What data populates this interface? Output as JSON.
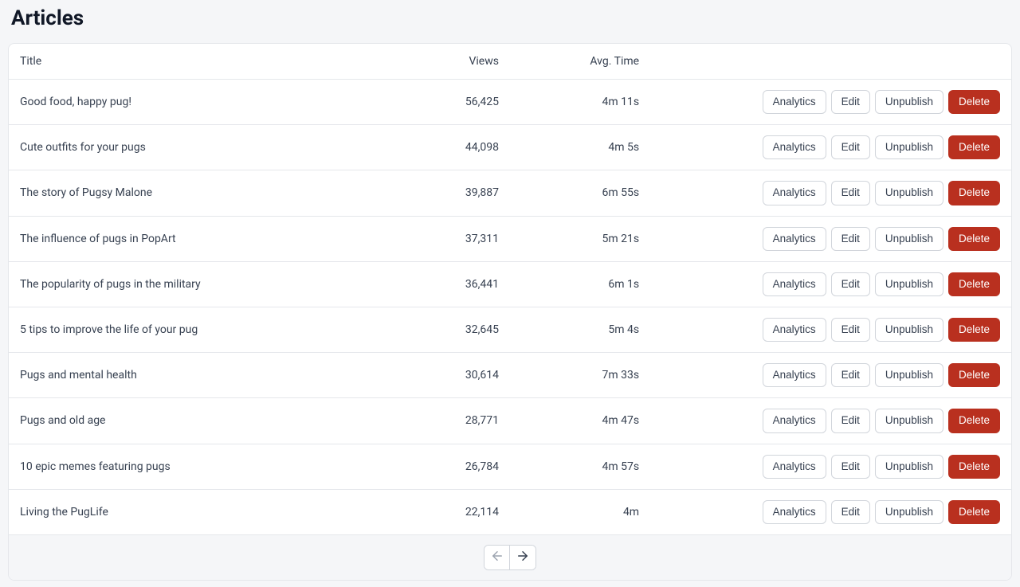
{
  "page": {
    "title": "Articles"
  },
  "table": {
    "headers": {
      "title": "Title",
      "views": "Views",
      "avg_time": "Avg. Time"
    },
    "rows": [
      {
        "title": "Good food, happy pug!",
        "views": "56,425",
        "avg_time": "4m 11s"
      },
      {
        "title": "Cute outfits for your pugs",
        "views": "44,098",
        "avg_time": "4m 5s"
      },
      {
        "title": "The story of Pugsy Malone",
        "views": "39,887",
        "avg_time": "6m 55s"
      },
      {
        "title": "The influence of pugs in PopArt",
        "views": "37,311",
        "avg_time": "5m 21s"
      },
      {
        "title": "The popularity of pugs in the military",
        "views": "36,441",
        "avg_time": "6m 1s"
      },
      {
        "title": "5 tips to improve the life of your pug",
        "views": "32,645",
        "avg_time": "5m 4s"
      },
      {
        "title": "Pugs and mental health",
        "views": "30,614",
        "avg_time": "7m 33s"
      },
      {
        "title": "Pugs and old age",
        "views": "28,771",
        "avg_time": "4m 47s"
      },
      {
        "title": "10 epic memes featuring pugs",
        "views": "26,784",
        "avg_time": "4m 57s"
      },
      {
        "title": "Living the PugLife",
        "views": "22,114",
        "avg_time": "4m"
      }
    ]
  },
  "actions": {
    "analytics": "Analytics",
    "edit": "Edit",
    "unpublish": "Unpublish",
    "delete": "Delete"
  },
  "pagination": {
    "prev_enabled": false,
    "next_enabled": true
  }
}
